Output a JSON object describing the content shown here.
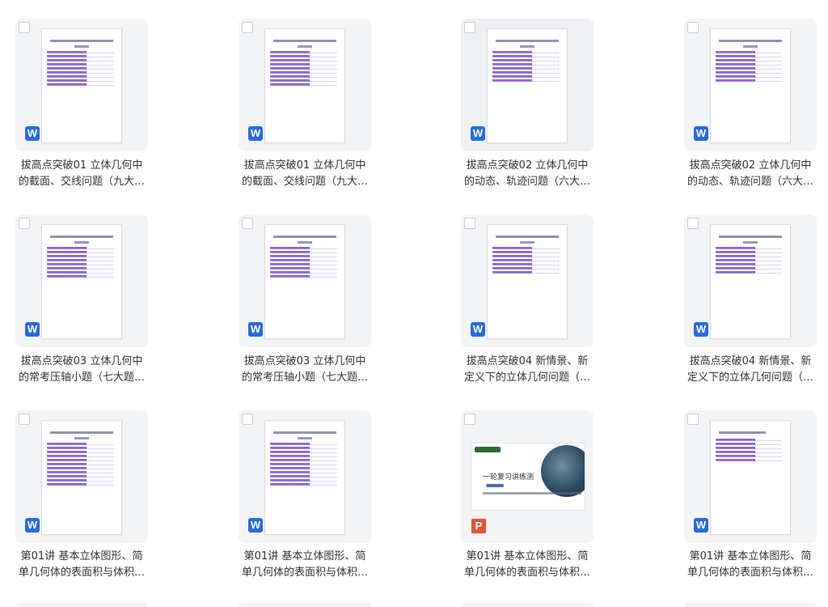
{
  "files": [
    {
      "line1": "拔高点突破01 立体几何中",
      "line2": "的截面、交线问题（九大…",
      "icon": "word-icon",
      "badge": "W"
    },
    {
      "line1": "拔高点突破01 立体几何中",
      "line2": "的截面、交线问题（九大…",
      "icon": "word-icon",
      "badge": "W"
    },
    {
      "line1": "拔高点突破02 立体几何中",
      "line2": "的动态、轨迹问题（六大…",
      "icon": "word-icon",
      "badge": "W"
    },
    {
      "line1": "拔高点突破02 立体几何中",
      "line2": "的动态、轨迹问题（六大…",
      "icon": "word-icon",
      "badge": "W"
    },
    {
      "line1": "拔高点突破03 立体几何中",
      "line2": "的常考压轴小题（七大题…",
      "icon": "word-icon",
      "badge": "W"
    },
    {
      "line1": "拔高点突破03 立体几何中",
      "line2": "的常考压轴小题（七大题…",
      "icon": "word-icon",
      "badge": "W"
    },
    {
      "line1": "拔高点突破04 新情景、新",
      "line2": "定义下的立体几何问题（…",
      "icon": "word-icon",
      "badge": "W"
    },
    {
      "line1": "拔高点突破04 新情景、新",
      "line2": "定义下的立体几何问题（…",
      "icon": "word-icon",
      "badge": "W"
    },
    {
      "line1": "第01讲 基本立体图形、简",
      "line2": "单几何体的表面积与体积…",
      "icon": "word-icon",
      "badge": "W"
    },
    {
      "line1": "第01讲 基本立体图形、简",
      "line2": "单几何体的表面积与体积…",
      "icon": "word-icon",
      "badge": "W"
    },
    {
      "line1": "第01讲 基本立体图形、简",
      "line2": "单几何体的表面积与体积…",
      "icon": "powerpoint-icon",
      "badge": "P",
      "slide_text": "一轮复习讲练测"
    },
    {
      "line1": "第01讲 基本立体图形、简",
      "line2": "单几何体的表面积与体积…",
      "icon": "word-icon",
      "badge": "W"
    }
  ]
}
